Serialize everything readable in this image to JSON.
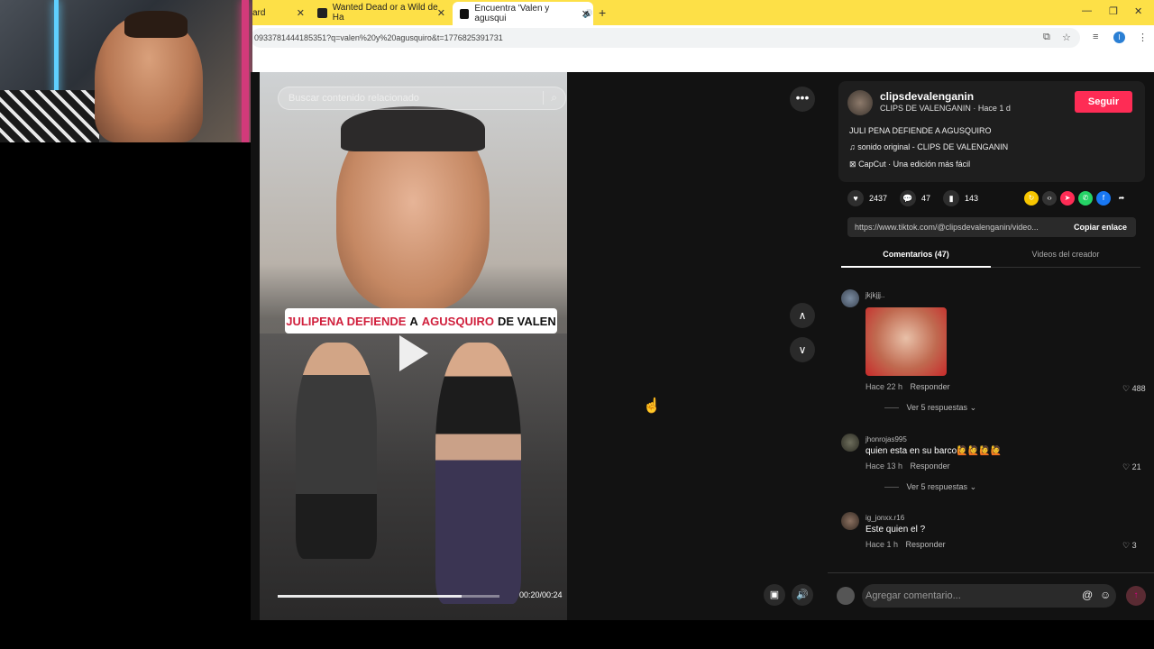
{
  "browser": {
    "tabs": [
      {
        "label": "ard",
        "active": false
      },
      {
        "label": "Wanted Dead or a Wild de Ha",
        "active": false
      },
      {
        "label": "Encuentra 'Valen y agusqui",
        "active": true
      }
    ],
    "url": "0933781444185351?q=valen%20y%20agusquiro&t=1776825391731",
    "profile_initial": "I"
  },
  "video": {
    "search_placeholder": "Buscar contenido relacionado",
    "caption_parts": [
      {
        "text": "JULIPENA DEFIENDE",
        "color": "red"
      },
      {
        "text": "A",
        "color": "black"
      },
      {
        "text": "AGUSQUIRO",
        "color": "red"
      },
      {
        "text": "DE VALEN",
        "color": "black"
      }
    ],
    "timecode": "00:20/00:24",
    "progress_fraction": 0.83
  },
  "author": {
    "username": "clipsdevalenganin",
    "subtitle": "CLIPS DE VALENGANIN · Hace 1 d",
    "follow_label": "Seguir",
    "description": "JULI PENA DEFIENDE A AGUSQUIRO",
    "music": "sonido original - CLIPS DE VALENGANIN",
    "capcut": "CapCut · Una edición más fácil"
  },
  "stats": {
    "likes": "2437",
    "comments": "47",
    "saves": "143"
  },
  "link": {
    "url": "https://www.tiktok.com/@clipsdevalenganin/video...",
    "copy_label": "Copiar enlace"
  },
  "tabs": {
    "comments": "Comentarios (47)",
    "creator_videos": "Videos del creador"
  },
  "comments": [
    {
      "user": "jkjkjjj..",
      "text": "",
      "time": "Hace 22 h",
      "reply": "Responder",
      "likes": "488",
      "replies": "Ver 5 respuestas"
    },
    {
      "user": "jhonrojas995",
      "text": "quien esta en su barco🙋🙋🙋🙋",
      "time": "Hace 13 h",
      "reply": "Responder",
      "likes": "21",
      "replies": "Ver 5 respuestas"
    },
    {
      "user": "ig_jonxx.r16",
      "text": "Este quien el ?",
      "time": "Hace 1 h",
      "reply": "Responder",
      "likes": "3"
    }
  ],
  "comment_bar": {
    "placeholder": "Agregar comentario..."
  },
  "colors": {
    "accent": "#fe2c55",
    "tabbar": "#fde047",
    "background": "#121212"
  }
}
